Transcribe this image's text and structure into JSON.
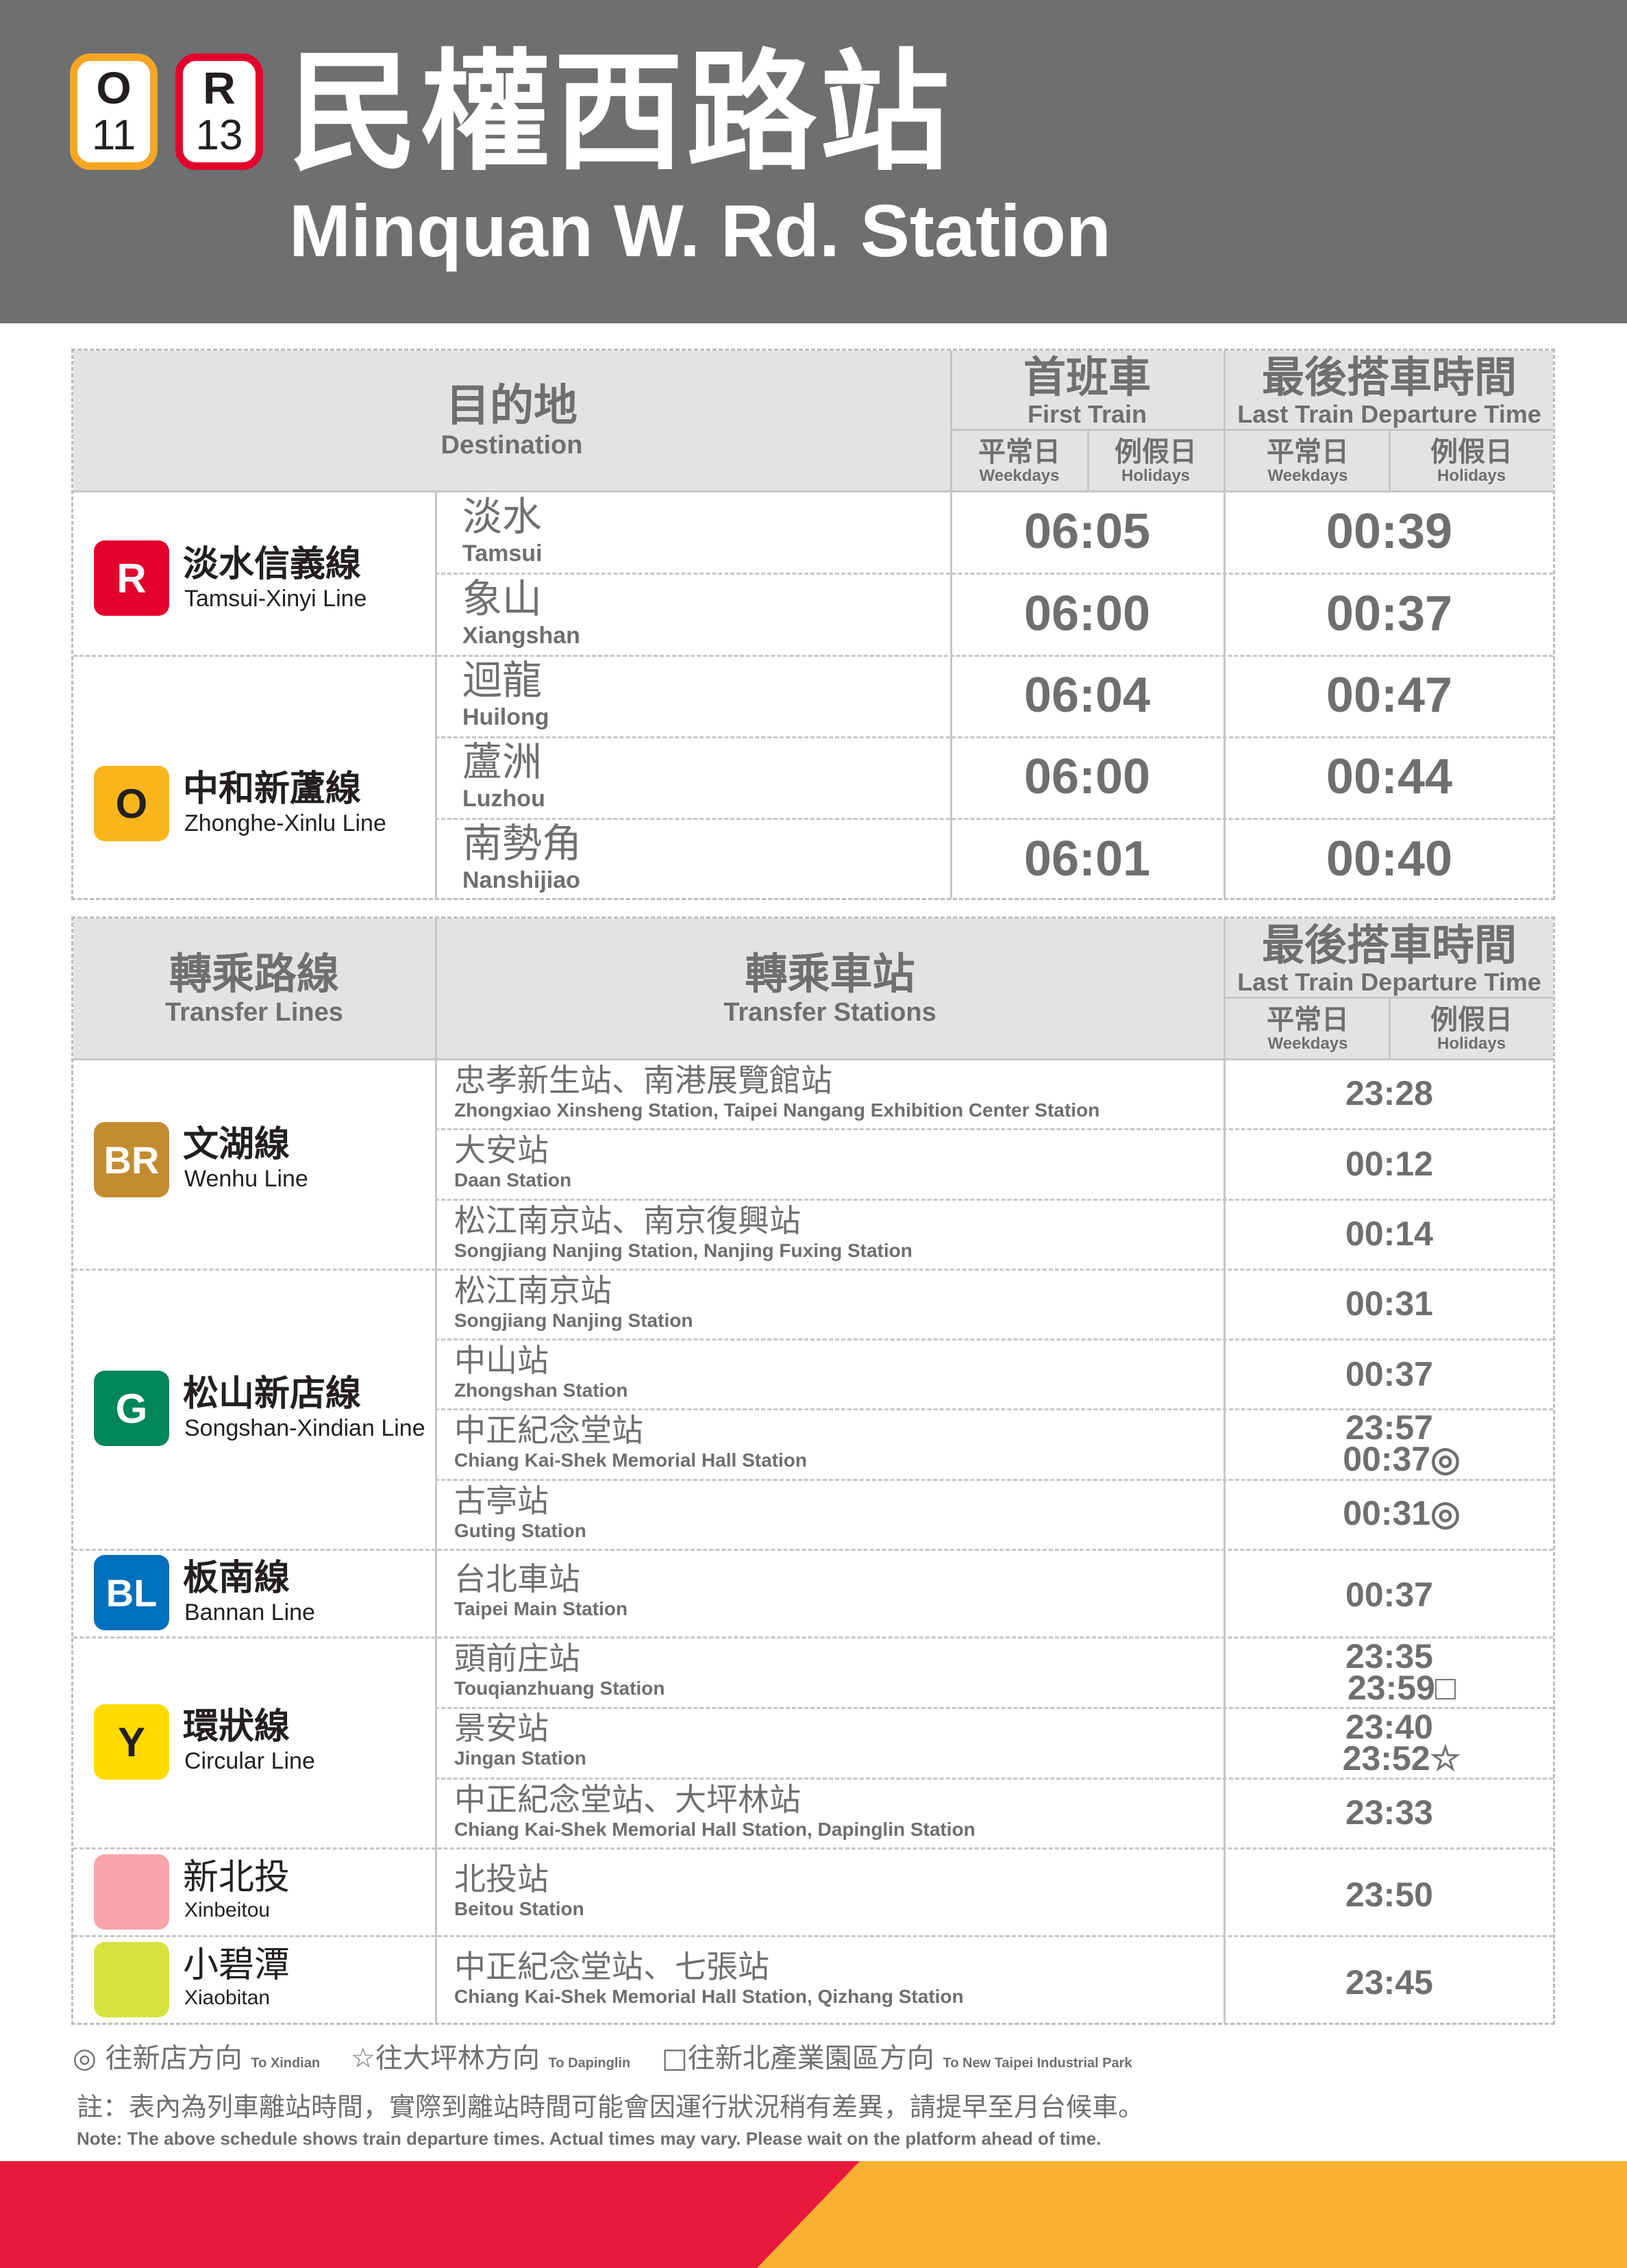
{
  "header": {
    "badges": [
      {
        "code": "O",
        "num": "11",
        "color": "#f6a623"
      },
      {
        "code": "R",
        "num": "13",
        "color": "#e3002c"
      }
    ],
    "station_zh": "民權西路站",
    "station_en": "Minquan W. Rd. Station"
  },
  "schedule": {
    "head": {
      "dest_zh": "目的地",
      "dest_en": "Destination",
      "first_zh": "首班車",
      "first_en": "First Train",
      "last_zh": "最後搭車時間",
      "last_en": "Last Train Departure Time",
      "weekdays_zh": "平常日",
      "weekdays_en": "Weekdays",
      "holidays_zh": "例假日",
      "holidays_en": "Holidays"
    },
    "lines": [
      {
        "code": "R",
        "color": "#e3002c",
        "zh": "淡水信義線",
        "en": "Tamsui-Xinyi Line"
      },
      {
        "code": "O",
        "color": "#f8b61c",
        "zh": "中和新蘆線",
        "en": "Zhonghe-Xinlu Line"
      }
    ],
    "rows": [
      {
        "zh": "淡水",
        "en": "Tamsui",
        "first": "06:05",
        "last": "00:39"
      },
      {
        "zh": "象山",
        "en": "Xiangshan",
        "first": "06:00",
        "last": "00:37"
      },
      {
        "zh": "迴龍",
        "en": "Huilong",
        "first": "06:04",
        "last": "00:47"
      },
      {
        "zh": "蘆洲",
        "en": "Luzhou",
        "first": "06:00",
        "last": "00:44"
      },
      {
        "zh": "南勢角",
        "en": "Nanshijiao",
        "first": "06:01",
        "last": "00:40"
      }
    ]
  },
  "transfer": {
    "head": {
      "lines_zh": "轉乘路線",
      "lines_en": "Transfer Lines",
      "stations_zh": "轉乘車站",
      "stations_en": "Transfer Stations",
      "last_zh": "最後搭車時間",
      "last_en": "Last Train Departure Time",
      "weekdays_zh": "平常日",
      "weekdays_en": "Weekdays",
      "holidays_zh": "例假日",
      "holidays_en": "Holidays"
    },
    "lines": [
      {
        "code": "BR",
        "color": "#c48c31",
        "zh": "文湖線",
        "en": "Wenhu Line"
      },
      {
        "code": "G",
        "color": "#008659",
        "zh": "松山新店線",
        "en": "Songshan-Xindian Line"
      },
      {
        "code": "BL",
        "color": "#0070bd",
        "zh": "板南線",
        "en": "Bannan Line"
      },
      {
        "code": "Y",
        "color": "#ffdb00",
        "zh": "環狀線",
        "en": "Circular Line"
      },
      {
        "code": "",
        "color": "#f8a4ab",
        "zh": "新北投",
        "en": "Xinbeitou"
      },
      {
        "code": "",
        "color": "#d7e33f",
        "zh": "小碧潭",
        "en": "Xiaobitan"
      }
    ],
    "rows": [
      {
        "zh": "忠孝新生站、南港展覽館站",
        "en": "Zhongxiao Xinsheng Station, Taipei Nangang Exhibition Center Station",
        "time1": "23:28",
        "time2": ""
      },
      {
        "zh": "大安站",
        "en": "Daan Station",
        "time1": "00:12",
        "time2": ""
      },
      {
        "zh": "松江南京站、南京復興站",
        "en": "Songjiang Nanjing Station, Nanjing Fuxing Station",
        "time1": "00:14",
        "time2": ""
      },
      {
        "zh": "松江南京站",
        "en": "Songjiang Nanjing Station",
        "time1": "00:31",
        "time2": ""
      },
      {
        "zh": "中山站",
        "en": "Zhongshan Station",
        "time1": "00:37",
        "time2": ""
      },
      {
        "zh": "中正紀念堂站",
        "en": "Chiang Kai-Shek Memorial Hall Station",
        "time1": "23:57",
        "time2": "00:37◎"
      },
      {
        "zh": "古亭站",
        "en": "Guting Station",
        "time1": "00:31◎",
        "time2": ""
      },
      {
        "zh": "台北車站",
        "en": "Taipei Main Station",
        "time1": "00:37",
        "time2": ""
      },
      {
        "zh": "頭前庄站",
        "en": "Touqianzhuang Station",
        "time1": "23:35",
        "time2": "23:59□"
      },
      {
        "zh": "景安站",
        "en": "Jingan Station",
        "time1": "23:40",
        "time2": "23:52☆"
      },
      {
        "zh": "中正紀念堂站、大坪林站",
        "en": "Chiang Kai-Shek Memorial Hall Station, Dapinglin Station",
        "time1": "23:33",
        "time2": ""
      },
      {
        "zh": "北投站",
        "en": "Beitou Station",
        "time1": "23:50",
        "time2": ""
      },
      {
        "zh": "中正紀念堂站、七張站",
        "en": "Chiang Kai-Shek Memorial Hall Station, Qizhang Station",
        "time1": "23:45",
        "time2": ""
      }
    ]
  },
  "legend": {
    "item1_zh": "◎ 往新店方向",
    "item1_en": "To Xindian",
    "item2_zh": "☆往大坪林方向",
    "item2_en": "To Dapinglin",
    "item3_zh": "□往新北產業園區方向",
    "item3_en": "To New Taipei Industrial Park"
  },
  "notes": {
    "zh": "註：表內為列車離站時間，實際到離站時間可能會因運行狀況稍有差異，請提早至月台候車。",
    "en": "Note: The above schedule shows train departure times. Actual times may vary. Please wait on the platform ahead of time."
  },
  "colors": {
    "header_bg": "#6e6f71",
    "bottom_red": "#e8193c",
    "bottom_orange": "#f8b133"
  }
}
